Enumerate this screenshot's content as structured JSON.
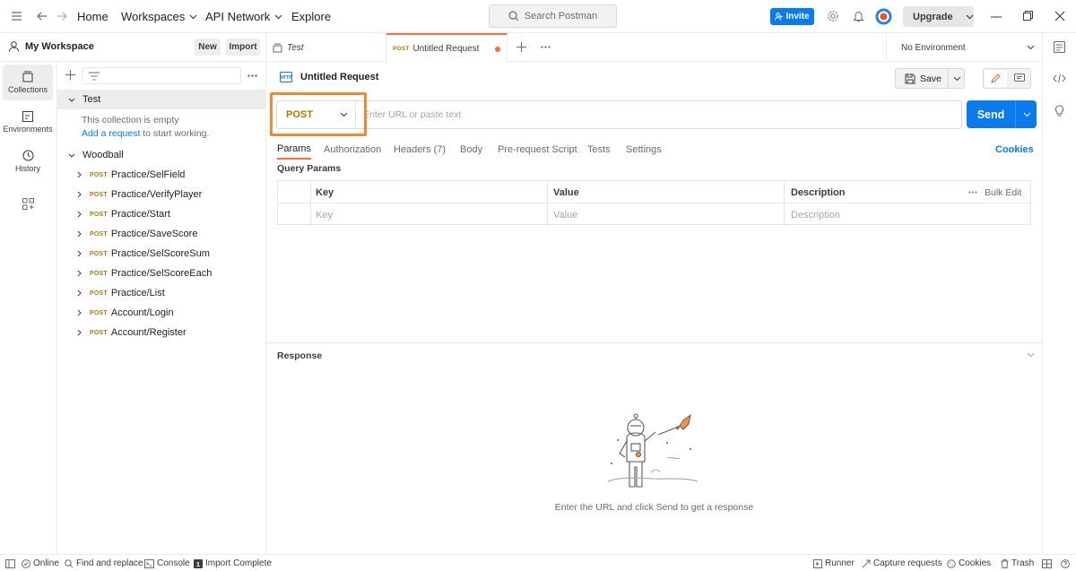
{
  "topbar": {
    "nav": {
      "home": "Home",
      "workspaces": "Workspaces",
      "api_network": "API Network",
      "explore": "Explore"
    },
    "search_placeholder": "Search Postman",
    "invite": "Invite",
    "upgrade": "Upgrade"
  },
  "workspace": {
    "name": "My Workspace",
    "new_label": "New",
    "import_label": "Import"
  },
  "rail": [
    {
      "label": "Collections",
      "icon": "collections-icon"
    },
    {
      "label": "Environments",
      "icon": "environments-icon"
    },
    {
      "label": "History",
      "icon": "history-icon"
    }
  ],
  "sidebar": {
    "collections": [
      {
        "name": "Test",
        "empty_text": "This collection is empty",
        "add_link": "Add a request",
        "add_rest": " to start working."
      },
      {
        "name": "Woodball",
        "requests": [
          {
            "method": "POST",
            "name": "Practice/SelField"
          },
          {
            "method": "POST",
            "name": "Practice/VerifyPlayer"
          },
          {
            "method": "POST",
            "name": "Practice/Start"
          },
          {
            "method": "POST",
            "name": "Practice/SaveScore"
          },
          {
            "method": "POST",
            "name": "Practice/SelScoreSum"
          },
          {
            "method": "POST",
            "name": "Practice/SelScoreEach"
          },
          {
            "method": "POST",
            "name": "Practice/List"
          },
          {
            "method": "POST",
            "name": "Account/Login"
          },
          {
            "method": "POST",
            "name": "Account/Register"
          }
        ]
      }
    ]
  },
  "tabs": [
    {
      "label": "Test",
      "method": ""
    },
    {
      "label": "Untitled Request",
      "method": "POST"
    }
  ],
  "environment": "No Environment",
  "request": {
    "title": "Untitled Request",
    "save_label": "Save",
    "method": "POST",
    "url_placeholder": "Enter URL or paste text",
    "send_label": "Send",
    "tabs": [
      "Params",
      "Authorization",
      "Headers (7)",
      "Body",
      "Pre-request Script",
      "Tests",
      "Settings"
    ],
    "cookies_label": "Cookies",
    "query_params_title": "Query Params",
    "columns": [
      "Key",
      "Value",
      "Description"
    ],
    "bulk_edit": "Bulk Edit",
    "row_placeholders": [
      "Key",
      "Value",
      "Description"
    ]
  },
  "response": {
    "title": "Response",
    "empty_text": "Enter the URL and click Send to get a response"
  },
  "statusbar": {
    "online": "Online",
    "find_replace": "Find and replace",
    "console": "Console",
    "import_complete": "Import Complete",
    "runner": "Runner",
    "capture": "Capture requests",
    "cookies": "Cookies",
    "trash": "Trash"
  },
  "colors": {
    "accent": "#097bed",
    "post": "#ad7a03",
    "tab_indicator": "#ff6c37",
    "highlight": "#f0882f"
  }
}
